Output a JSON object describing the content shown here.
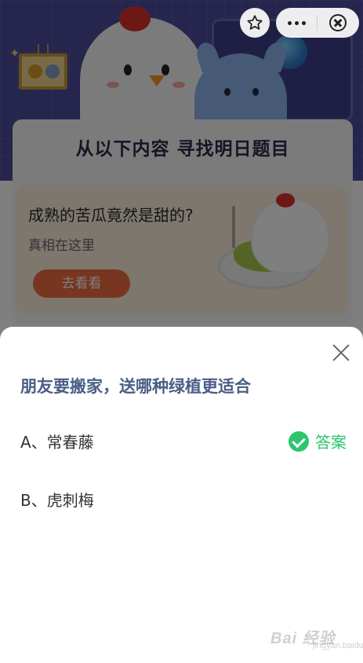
{
  "banner": {
    "title": "从以下内容 寻找明日题目"
  },
  "promo": {
    "title": "成熟的苦瓜竟然是甜的?",
    "subtitle": "真相在这里",
    "button_label": "去看看"
  },
  "quiz": {
    "question": "朋友要搬家，送哪种绿植更适合",
    "options": [
      {
        "label": "A、常春藤"
      },
      {
        "label": "B、虎刺梅"
      }
    ],
    "answer_label": "答案",
    "answer_color": "#2cc56f"
  },
  "watermark": {
    "main": "Bai 经验",
    "sub": "jingyan.baidu.com"
  },
  "colors": {
    "hero_bg": "#4a4a9c",
    "promo_button": "#f06b3e",
    "question_text": "#4a5e86"
  }
}
